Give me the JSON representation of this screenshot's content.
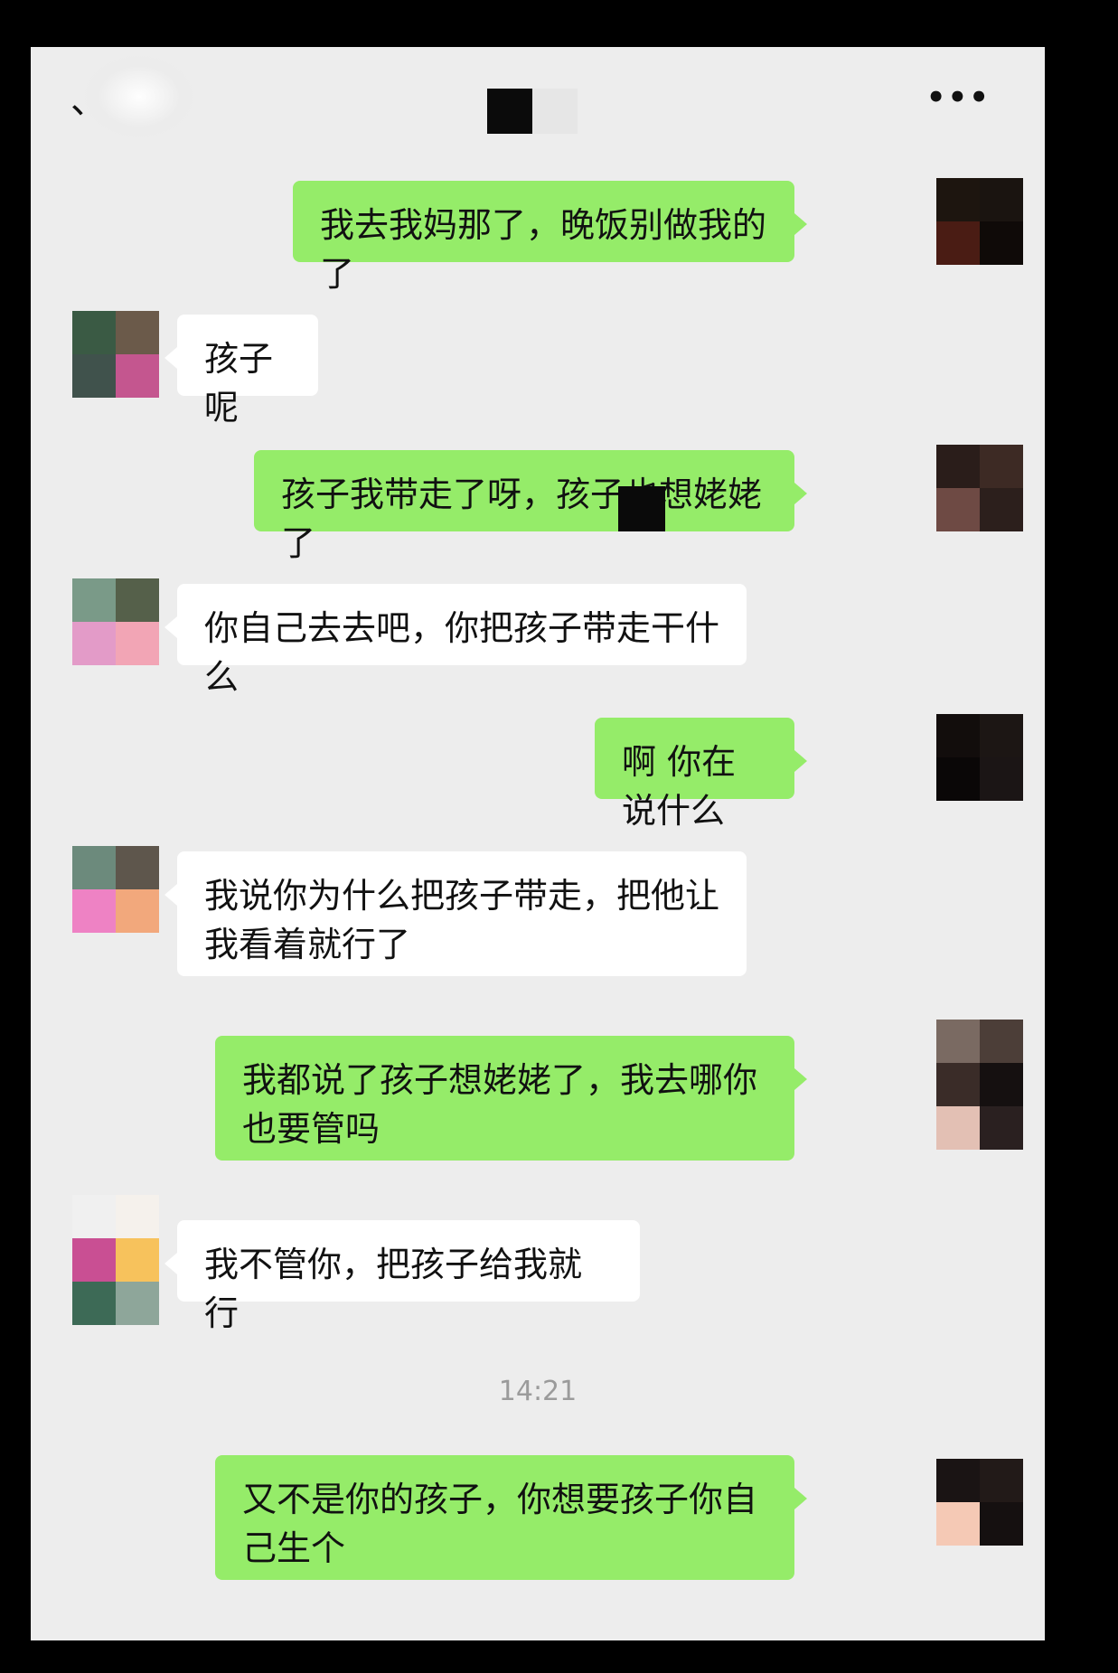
{
  "header": {
    "back_glyph": "、",
    "more_glyph": "•••",
    "title_mosaic": [
      "#0b0b0b",
      "#e6e6e6"
    ]
  },
  "messages": [
    {
      "side": "me",
      "text": "我去我妈那了，晚饭别做我的了",
      "avatar": [
        "#1d150f",
        "#1a1410",
        "#4a1c14",
        "#0f0a08"
      ]
    },
    {
      "side": "other",
      "text": "孩子呢",
      "avatar": [
        "#3a5a44",
        "#6b5a4a",
        "#40524c",
        "#c4568f"
      ]
    },
    {
      "side": "me",
      "text": "孩子我带走了呀，孩子也想姥姥了",
      "avatar": [
        "#2a1d1a",
        "#3d2a24",
        "#6e4a44",
        "#2c1f1c"
      ]
    },
    {
      "side": "other",
      "text": "你自己去去吧，你把孩子带走干什么",
      "avatar": [
        "#7a9a88",
        "#55604a",
        "#e39bc8",
        "#f2a5b5"
      ]
    },
    {
      "side": "me",
      "text": "啊 你在说什么",
      "avatar": [
        "#120d0c",
        "#1c1614",
        "#0a0707",
        "#1b1515"
      ]
    },
    {
      "side": "other",
      "text": "我说你为什么把孩子带走，把他让我看着就行了",
      "avatar": [
        "#6c8a7c",
        "#5e564c",
        "#ee82c4",
        "#f2a87c"
      ]
    },
    {
      "side": "me",
      "text": "我都说了孩子想姥姥了，我去哪你也要管吗",
      "avatar": [
        "#7a6a62",
        "#4c3e38",
        "#3a2c28",
        "#151010",
        "#e3c0b4",
        "#2a2020"
      ]
    },
    {
      "side": "other",
      "text": "我不管你，把孩子给我就行",
      "avatar": [
        "#f0f0f0",
        "#f5f1ec",
        "#c94f93",
        "#f7c25c",
        "#3d6a56",
        "#8ea69a"
      ]
    },
    {
      "side": "me",
      "text": "又不是你的孩子，你想要孩子你自己生个",
      "avatar": [
        "#1a1414",
        "#221a18",
        "#f5c9b5",
        "#151010"
      ]
    }
  ],
  "timestamp": "14:21"
}
